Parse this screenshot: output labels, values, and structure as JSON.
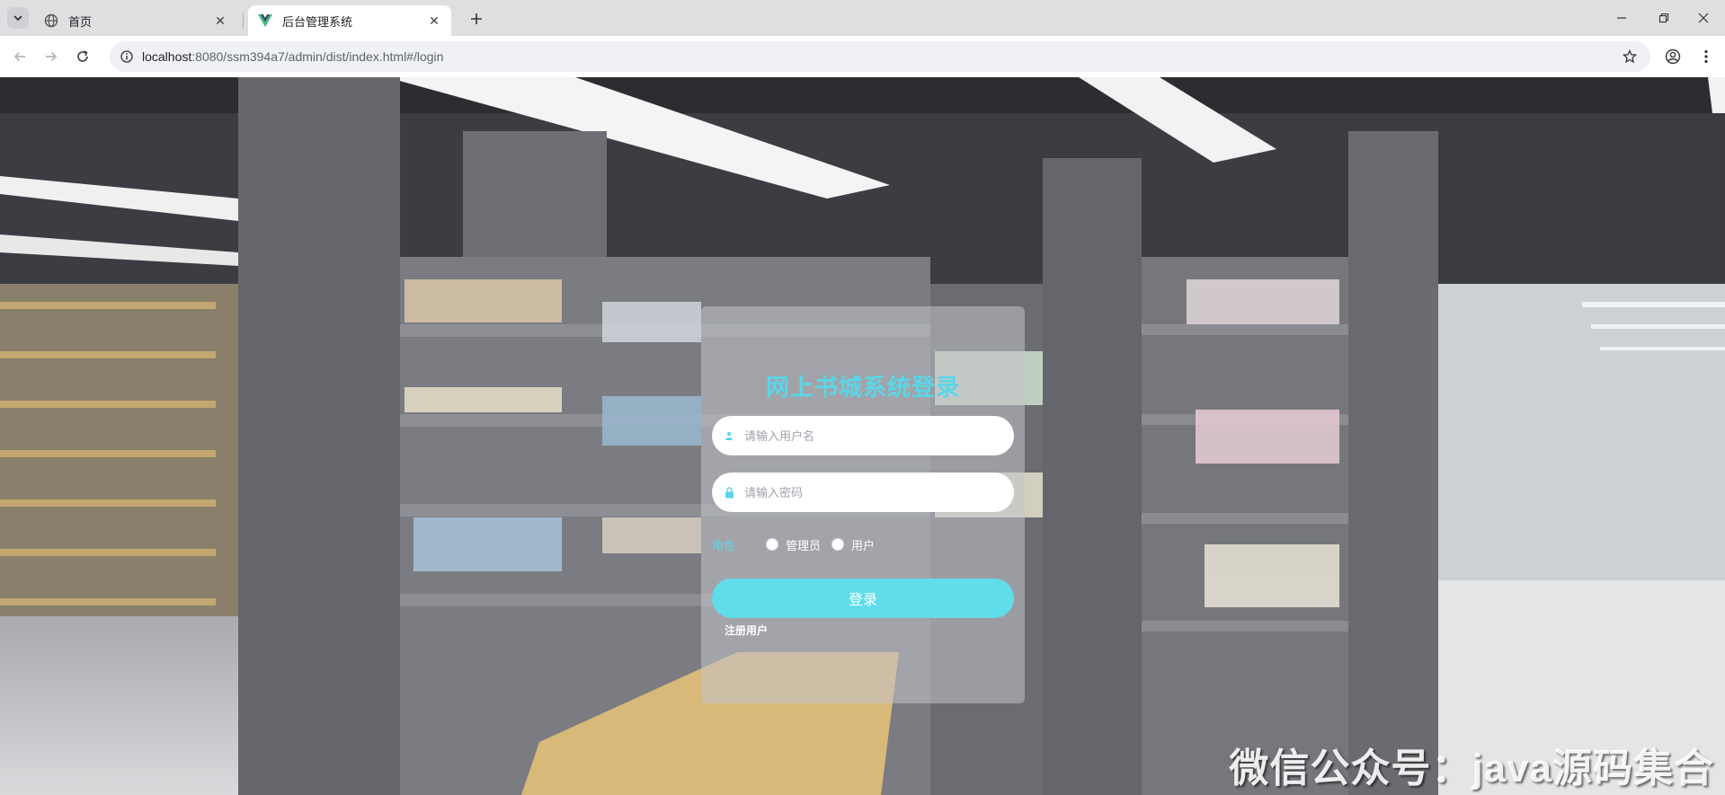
{
  "browser": {
    "tabs": [
      {
        "title": "首页",
        "favicon": "globe-icon",
        "active": false
      },
      {
        "title": "后台管理系统",
        "favicon": "vue-logo-icon",
        "active": true
      }
    ],
    "url_host": "localhost",
    "url_path": ":8080/ssm394a7/admin/dist/index.html#/login"
  },
  "login": {
    "title": "网上书城系统登录",
    "username_placeholder": "请输入用户名",
    "password_placeholder": "请输入密码",
    "role_label": "角色",
    "roles": [
      "管理员",
      "用户"
    ],
    "submit_label": "登录",
    "register_label": "注册用户"
  },
  "watermark": "微信公众号：java源码集合",
  "colors": {
    "accent": "#5ad6e8",
    "button": "#60dcea",
    "tab_active": "#ffffff",
    "tabstrip": "#dedfe1"
  }
}
